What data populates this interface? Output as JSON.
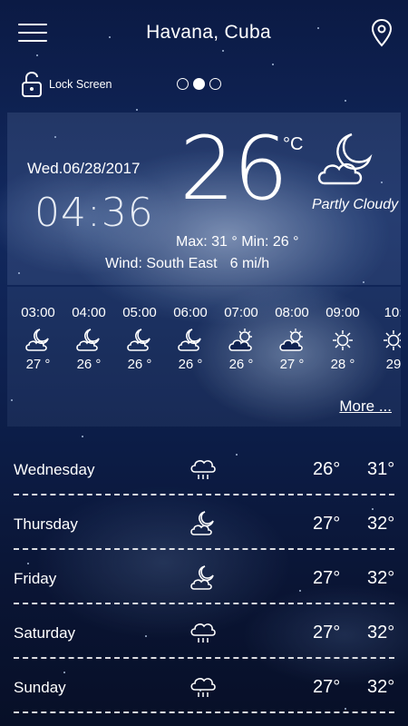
{
  "header": {
    "city": "Havana, Cuba",
    "lock_label": "Lock Screen",
    "pages": 3,
    "active_page": 1
  },
  "current": {
    "date": "Wed.06/28/2017",
    "time": "04:36",
    "temp": "26",
    "unit": "°C",
    "condition": "Partly Cloudy",
    "condition_icon": "moon-cloud-icon",
    "max": "Max: 31 °",
    "min": "Min: 26 °",
    "wind": "Wind: South East",
    "wind_speed": "6 mi/h"
  },
  "hourly": [
    {
      "time": "03:00",
      "temp": "27 °",
      "icon": "moon-cloud-icon"
    },
    {
      "time": "04:00",
      "temp": "26 °",
      "icon": "moon-cloud-icon"
    },
    {
      "time": "05:00",
      "temp": "26 °",
      "icon": "moon-cloud-icon"
    },
    {
      "time": "06:00",
      "temp": "26 °",
      "icon": "moon-cloud-icon"
    },
    {
      "time": "07:00",
      "temp": "26 °",
      "icon": "sun-cloud-icon"
    },
    {
      "time": "08:00",
      "temp": "27 °",
      "icon": "sun-cloud-icon"
    },
    {
      "time": "09:00",
      "temp": "28 °",
      "icon": "sun-icon"
    },
    {
      "time": "10:",
      "temp": "29",
      "icon": "sun-icon"
    }
  ],
  "more_label": "More ...",
  "daily": [
    {
      "day": "Wednesday",
      "low": "26°",
      "high": "31°",
      "icon": "rain-cloud-icon"
    },
    {
      "day": "Thursday",
      "low": "27°",
      "high": "32°",
      "icon": "moon-cloud-icon"
    },
    {
      "day": "Friday",
      "low": "27°",
      "high": "32°",
      "icon": "moon-cloud-icon"
    },
    {
      "day": "Saturday",
      "low": "27°",
      "high": "32°",
      "icon": "rain-cloud-icon"
    },
    {
      "day": "Sunday",
      "low": "27°",
      "high": "32°",
      "icon": "rain-cloud-icon"
    }
  ]
}
